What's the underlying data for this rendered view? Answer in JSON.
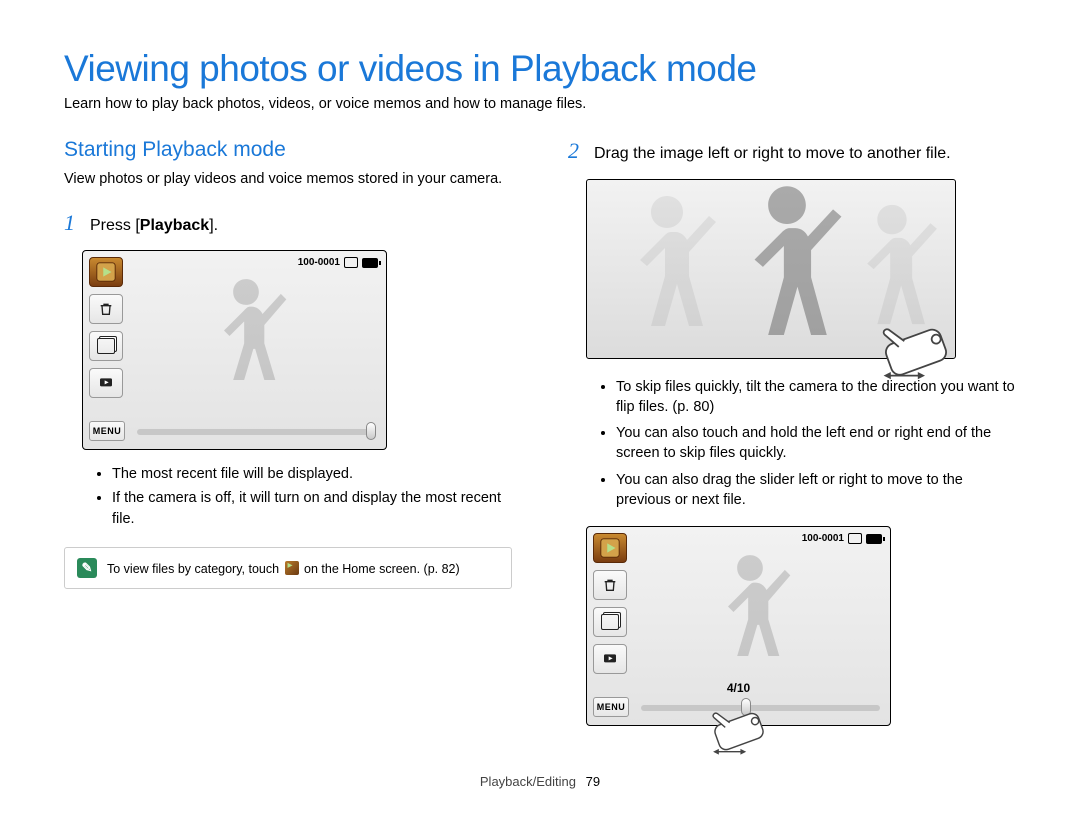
{
  "title": "Viewing photos or videos in Playback mode",
  "subtitle": "Learn how to play back photos, videos, or voice memos and how to manage files.",
  "left": {
    "section_title": "Starting Playback mode",
    "section_desc": "View photos or play videos and voice memos stored in your camera.",
    "step1_num": "1",
    "step1_pre": "Press [",
    "step1_bold": "Playback",
    "step1_post": "].",
    "lcd": {
      "file_no": "100-0001",
      "menu": "MENU"
    },
    "bullets": [
      "The most recent file will be displayed.",
      "If the camera is off, it will turn on and display the most recent file."
    ],
    "note_pre": "To view files by category, touch ",
    "note_post": " on the Home screen. (p. 82)"
  },
  "right": {
    "step2_num": "2",
    "step2_text": "Drag the image left or right to move to another file.",
    "bullets": [
      "To skip files quickly, tilt the camera to the direction you want to flip files. (p. 80)",
      "You can also touch and hold the left end or right end of the screen to skip files quickly.",
      "You can also drag the slider left or right to move to the previous or next file."
    ],
    "lcd": {
      "file_no": "100-0001",
      "menu": "MENU",
      "counter": "4/10"
    }
  },
  "footer": {
    "section": "Playback/Editing",
    "page": "79"
  }
}
